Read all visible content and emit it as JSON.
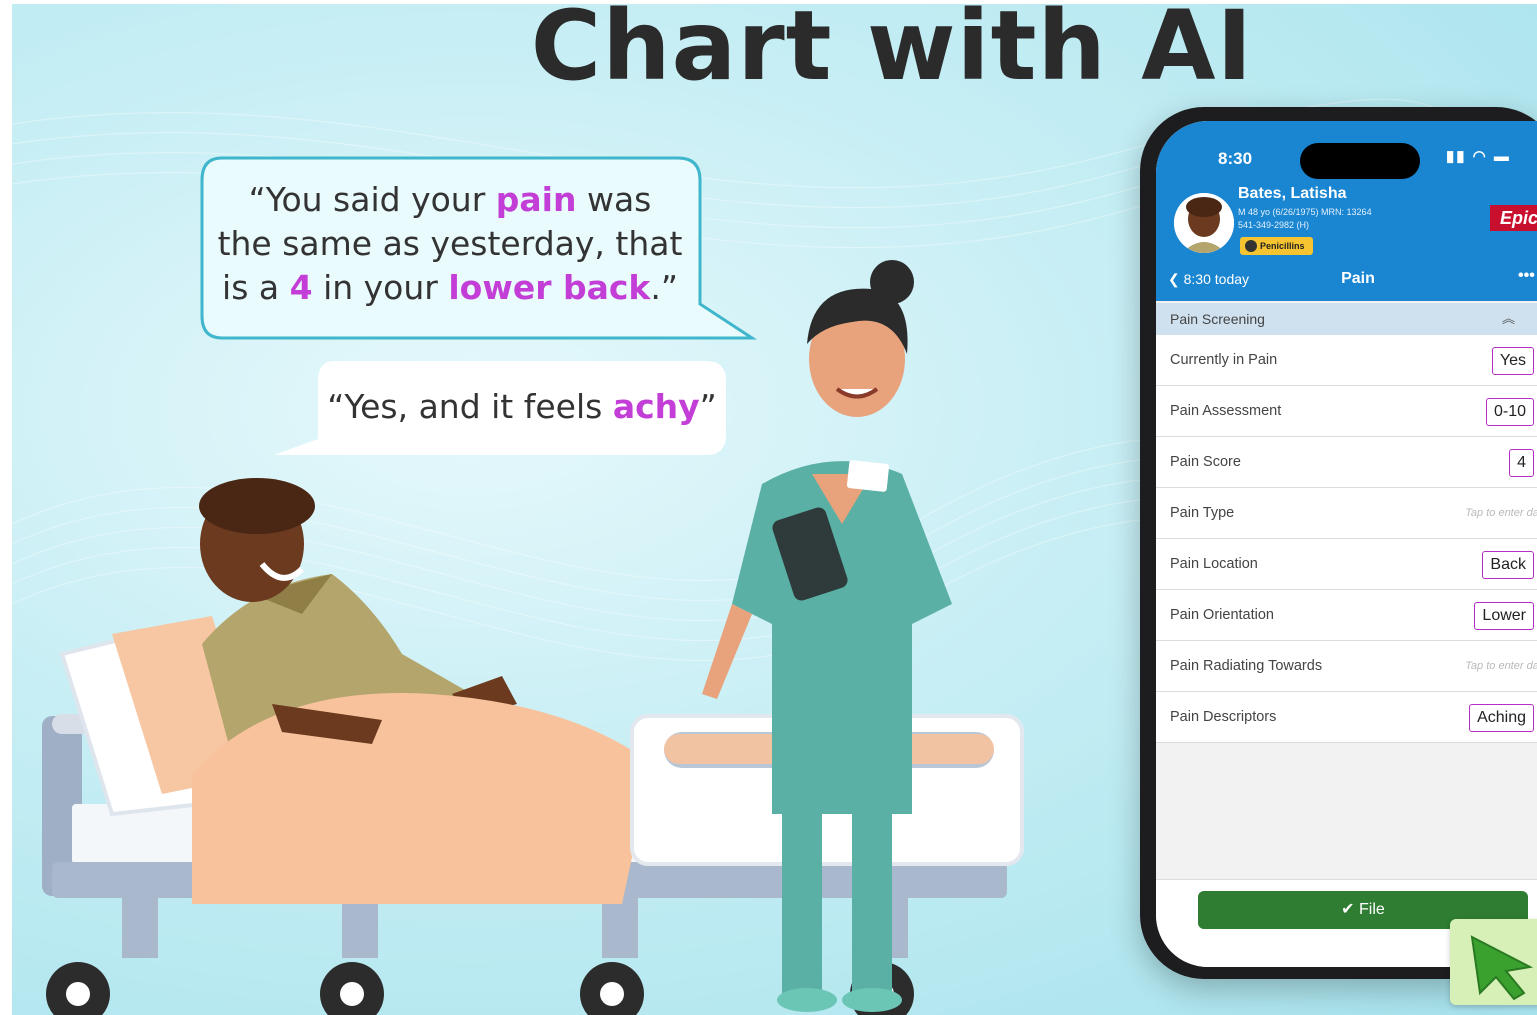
{
  "headline": "Chart with AI",
  "nurse_bubble": {
    "line1_pre": "“You said your ",
    "line1_hl": "pain",
    "line1_post": " was",
    "line2": "the same as yesterday, that",
    "line3_pre": "is a ",
    "line3_hl1": "4",
    "line3_mid": " in your ",
    "line3_hl2": "lower back",
    "line3_post": ".”"
  },
  "patient_bubble": {
    "pre": "“Yes, and it feels ",
    "hl": "achy",
    "post": "”"
  },
  "phone": {
    "time": "8:30",
    "status_icons": "▮▮ ◠ ▬",
    "patient": {
      "name": "Bates, Latisha",
      "meta_line1": "M 48 yo (6/26/1975)  MRN: 13264",
      "meta_line2": "541-349-2982 (H)",
      "allergy": "Penicillins"
    },
    "logo": "Epic",
    "nav": {
      "back": "8:30 today",
      "title": "Pain",
      "more": "•••"
    },
    "section": "Pain Screening",
    "rows": [
      {
        "label": "Currently in Pain",
        "value": "Yes"
      },
      {
        "label": "Pain Assessment",
        "value": "0-10"
      },
      {
        "label": "Pain Score",
        "value": "4"
      },
      {
        "label": "Pain Type",
        "placeholder": "Tap to enter data"
      },
      {
        "label": "Pain Location",
        "value": "Back"
      },
      {
        "label": "Pain Orientation",
        "value": "Lower"
      },
      {
        "label": "Pain Radiating Towards",
        "placeholder": "Tap to enter data"
      },
      {
        "label": "Pain Descriptors",
        "value": "Aching"
      }
    ],
    "file_button": "File"
  },
  "colors": {
    "highlight": "#c23ed6",
    "epic_blue": "#1a85d0",
    "file_green": "#2e7d32",
    "value_border": "#b52fc4"
  }
}
